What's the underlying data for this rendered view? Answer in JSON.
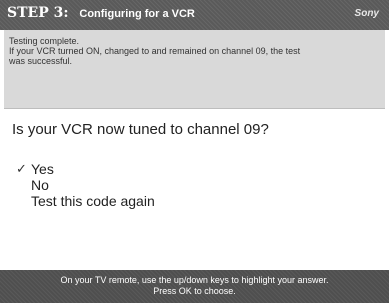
{
  "header": {
    "step": "STEP 3:",
    "title": "Configuring for a VCR",
    "logo": "Sony"
  },
  "status": {
    "line1": "Testing complete.",
    "line2": "If your VCR turned ON, changed to and remained on channel 09, the test",
    "line3": "was successful."
  },
  "question": "Is your VCR now tuned to channel 09?",
  "options": [
    {
      "label": "Yes",
      "checked": true
    },
    {
      "label": "No",
      "checked": false
    },
    {
      "label": "Test this code again",
      "checked": false
    }
  ],
  "check_glyph": "✓",
  "instructions": {
    "line1": "On your TV remote, use the up/down keys to highlight your answer.",
    "line2": "Press OK to choose."
  }
}
